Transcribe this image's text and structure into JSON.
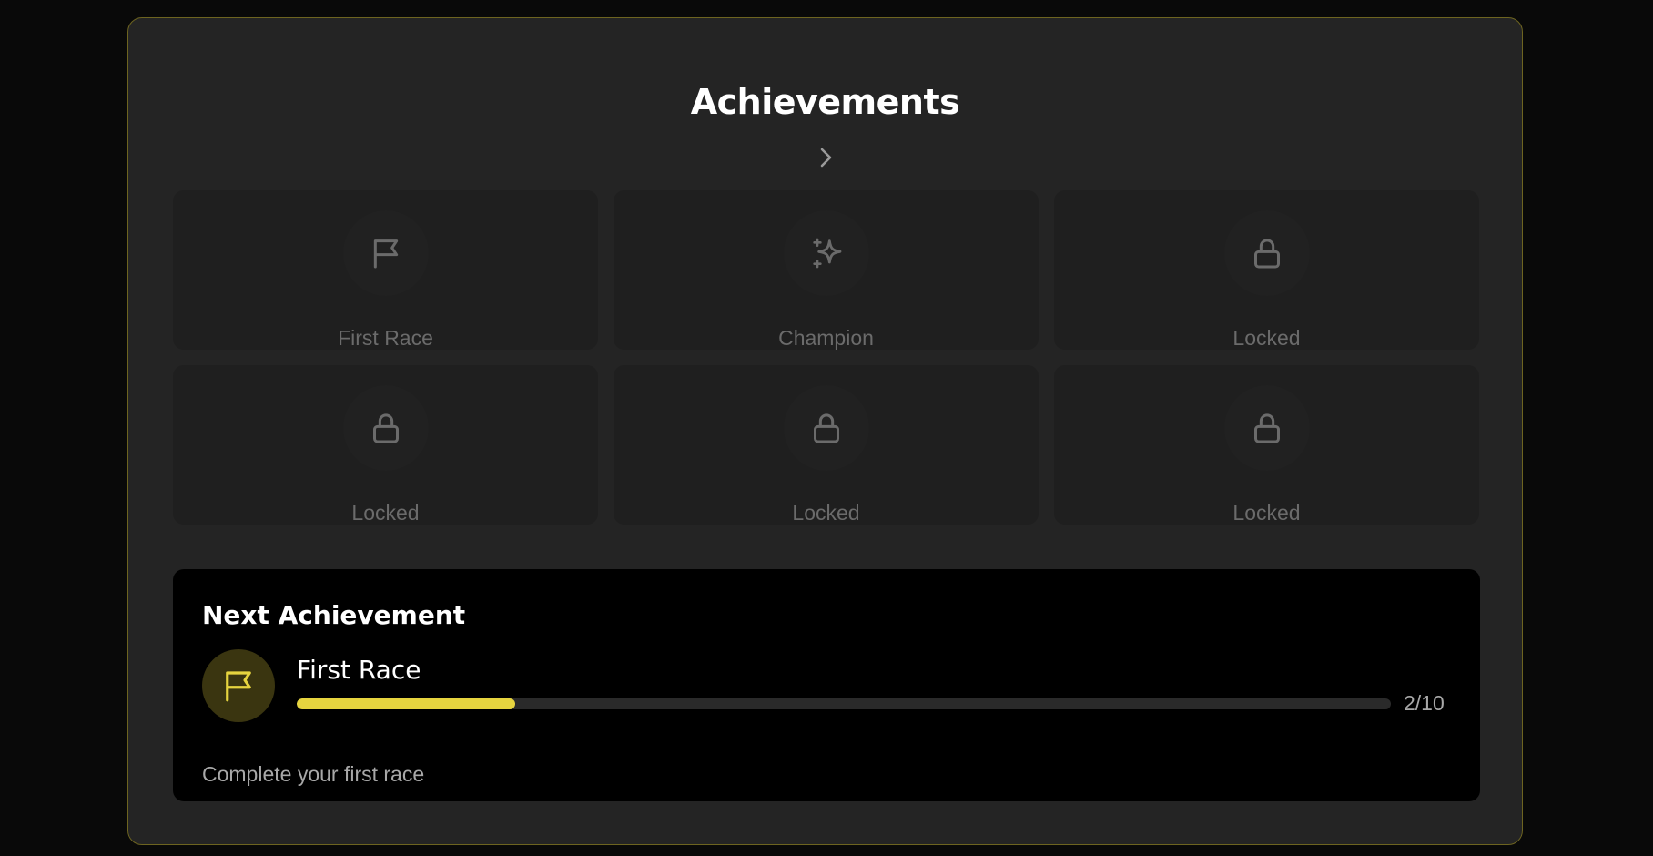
{
  "header": {
    "title": "Achievements"
  },
  "achievements": [
    {
      "label": "First Race",
      "icon": "flag-icon",
      "state": "unlocked"
    },
    {
      "label": "Champion",
      "icon": "sparkles-icon",
      "state": "unlocked"
    },
    {
      "label": "Locked",
      "icon": "lock-icon",
      "state": "locked"
    },
    {
      "label": "Locked",
      "icon": "lock-icon",
      "state": "locked"
    },
    {
      "label": "Locked",
      "icon": "lock-icon",
      "state": "locked"
    },
    {
      "label": "Locked",
      "icon": "lock-icon",
      "state": "locked"
    }
  ],
  "next": {
    "heading": "Next Achievement",
    "name": "First Race",
    "icon": "flag-icon",
    "progress": {
      "current": 2,
      "total": 10,
      "label": "2/10"
    },
    "description": "Complete your first race"
  },
  "colors": {
    "accent": "#e6d43f",
    "panel_border": "#6d6420",
    "background": "#090909",
    "panel": "#242424",
    "card": "#1f1f1f",
    "muted_text": "#6b6b6b"
  }
}
